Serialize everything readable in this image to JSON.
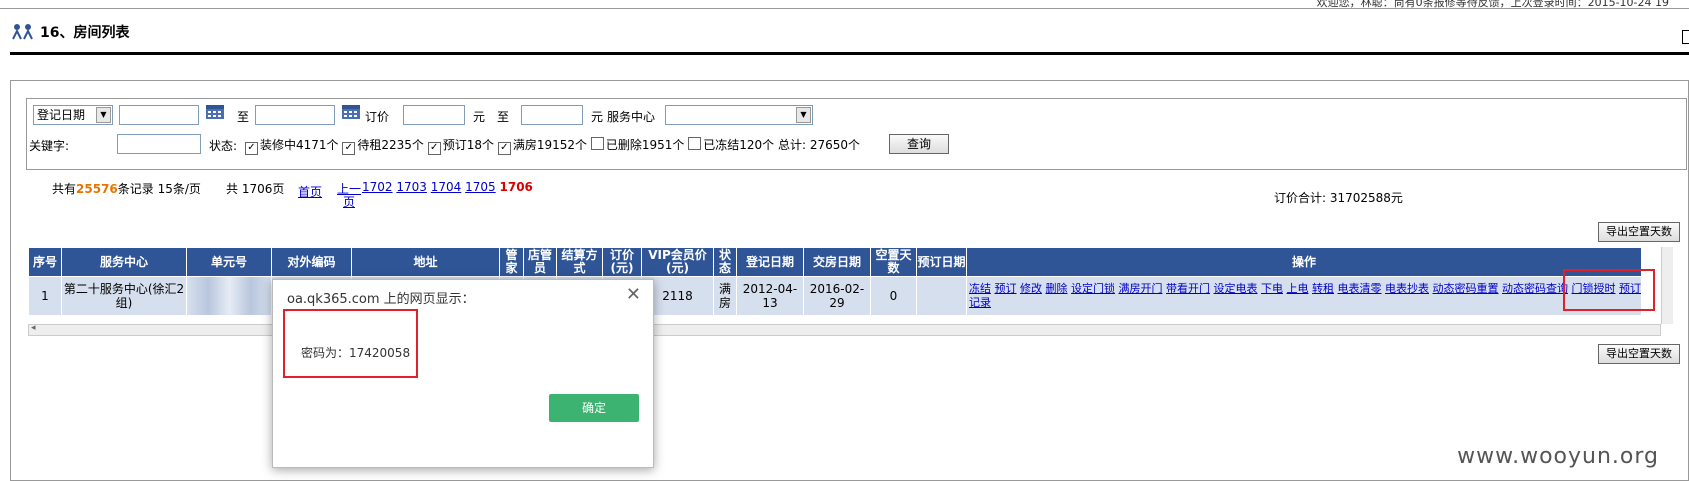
{
  "top_bar": {
    "text": "欢迎您，林聪：尚有0条报修等待反馈，上次登录时间：2015-10-24 19"
  },
  "page": {
    "title": "16、房间列表",
    "icon": "people-icon"
  },
  "filter": {
    "date_type": "登记日期",
    "to_label": "至",
    "price_label": "订价",
    "yuan1": "元",
    "to_label2": "至",
    "yuan2": "元",
    "service_center_label": "服务中心",
    "keyword_label": "关键字:",
    "status_label": "状态:",
    "statuses": [
      {
        "label": "装修中4171个",
        "checked": true
      },
      {
        "label": "待租2235个",
        "checked": true
      },
      {
        "label": "预订18个",
        "checked": true
      },
      {
        "label": "满房19152个",
        "checked": true
      },
      {
        "label": "已删除1951个",
        "checked": false
      },
      {
        "label": "已冻结120个",
        "checked": false
      }
    ],
    "total": "总计: 27650个",
    "query_button": "查询"
  },
  "pager": {
    "total_prefix": "共有",
    "total_records": "25576",
    "total_suffix": "条记录 15条/页",
    "pages": "共 1706页",
    "first": "首页",
    "prev_line1": "上一",
    "prev_line2": "页",
    "page_links": [
      "1702",
      "1703",
      "1704",
      "1705"
    ],
    "current_page": "1706",
    "sum_label": "订价合计: 31702588元"
  },
  "export_button": "导出空置天数",
  "table": {
    "headers": [
      "序号",
      "服务中心",
      "单元号",
      "对外编码",
      "地址",
      "管家",
      "店管员",
      "结算方式",
      "订价(元)",
      "VIP会员价(元)",
      "状态",
      "登记日期",
      "交房日期",
      "空置天数",
      "预订日期",
      "操作"
    ],
    "row": {
      "index": "1",
      "center": "第二十服务中心(徐汇2组)",
      "price": "2118",
      "status": "满房",
      "reg_date": "2012-04-13",
      "delivery_date": "2016-02-29",
      "vacant_days": "0"
    },
    "actions": [
      "冻结",
      "预订",
      "修改",
      "删除",
      "设定门锁",
      "满房开门",
      "带看开门",
      "设定电表",
      "下电",
      "上电",
      "转租",
      "电表清零",
      "电表抄表",
      "动态密码重置",
      "动态密码查询",
      "门锁授时",
      "预订记录"
    ]
  },
  "dialog": {
    "title": "oa.qk365.com 上的网页显示：",
    "message": "密码为：17420058",
    "ok": "确定"
  },
  "watermark": "www.wooyun.org"
}
